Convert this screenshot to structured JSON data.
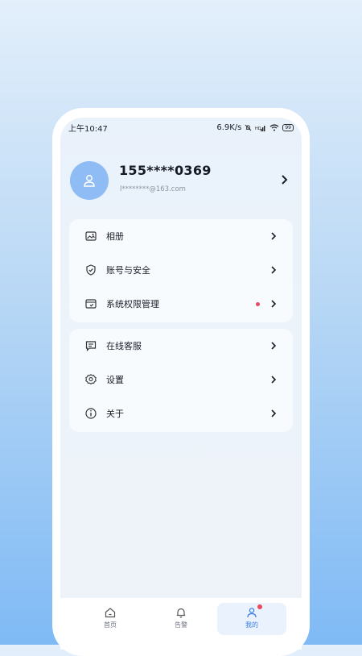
{
  "status_bar": {
    "time": "上午10:47",
    "speed": "6.9K/s",
    "battery": "99"
  },
  "profile": {
    "phone": "155****0369",
    "email": "l********@163.com"
  },
  "menu_group_1": [
    {
      "label": "相册",
      "icon": "photo-album-icon",
      "has_dot": false
    },
    {
      "label": "账号与安全",
      "icon": "shield-check-icon",
      "has_dot": false
    },
    {
      "label": "系统权限管理",
      "icon": "permission-calendar-icon",
      "has_dot": true
    }
  ],
  "menu_group_2": [
    {
      "label": "在线客服",
      "icon": "chat-icon"
    },
    {
      "label": "设置",
      "icon": "gear-icon"
    },
    {
      "label": "关于",
      "icon": "info-icon"
    }
  ],
  "tabbar": {
    "items": [
      {
        "label": "首页",
        "icon": "home-icon",
        "active": false
      },
      {
        "label": "告警",
        "icon": "bell-icon",
        "active": false
      },
      {
        "label": "我的",
        "icon": "user-icon",
        "active": true
      }
    ]
  },
  "colors": {
    "accent": "#3b7ee5",
    "avatar_bg": "#8fbcf5",
    "dot": "#e84a5f"
  }
}
